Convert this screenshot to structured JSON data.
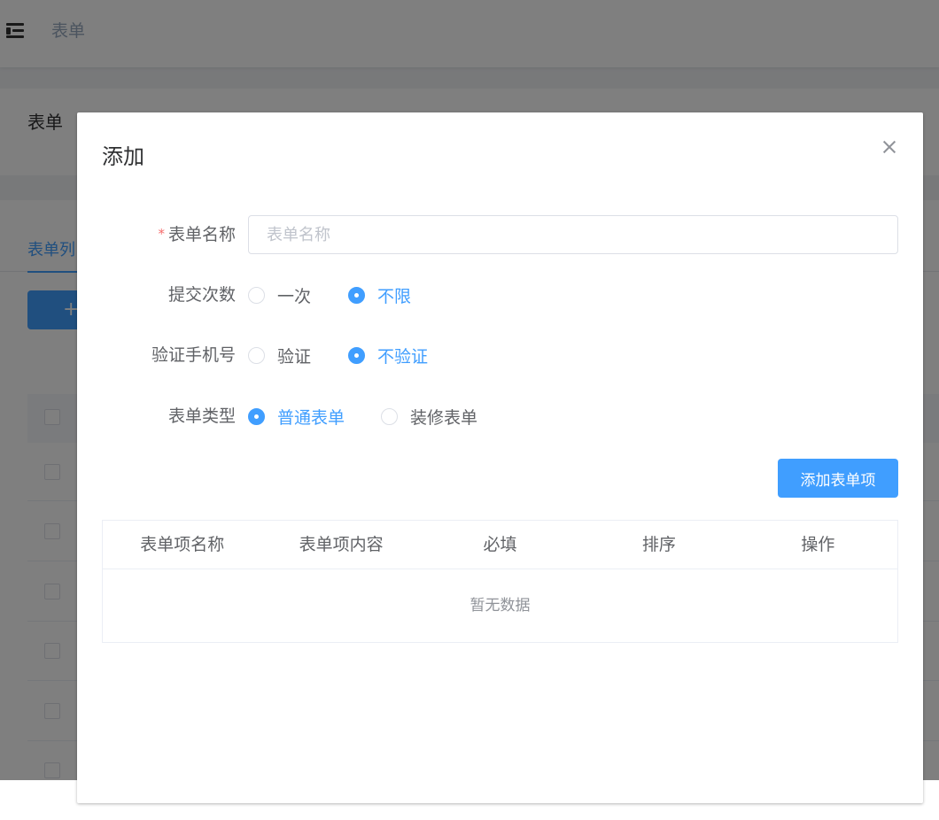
{
  "topbar": {
    "breadcrumb": "表单",
    "menu_icon": "menu-fold-icon"
  },
  "page": {
    "title": "表单"
  },
  "background": {
    "tab_label": "表单列",
    "add_button_label": "+"
  },
  "dialog": {
    "title": "添加",
    "close_icon": "close-icon",
    "form": {
      "name": {
        "label": "表单名称",
        "required_mark": "*",
        "value": "",
        "placeholder": "表单名称"
      },
      "submit_times": {
        "label": "提交次数",
        "options": [
          "一次",
          "不限"
        ],
        "selected": "不限"
      },
      "verify_phone": {
        "label": "验证手机号",
        "options": [
          "验证",
          "不验证"
        ],
        "selected": "不验证"
      },
      "form_type": {
        "label": "表单类型",
        "options": [
          "普通表单",
          "装修表单"
        ],
        "selected": "普通表单"
      }
    },
    "add_item_button": "添加表单项",
    "items_table": {
      "columns": [
        "表单项名称",
        "表单项内容",
        "必填",
        "排序",
        "操作"
      ],
      "empty_text": "暂无数据"
    }
  },
  "colors": {
    "primary": "#409eff",
    "required": "#f56c6c",
    "overlay": "rgba(0,0,0,0.5)"
  }
}
